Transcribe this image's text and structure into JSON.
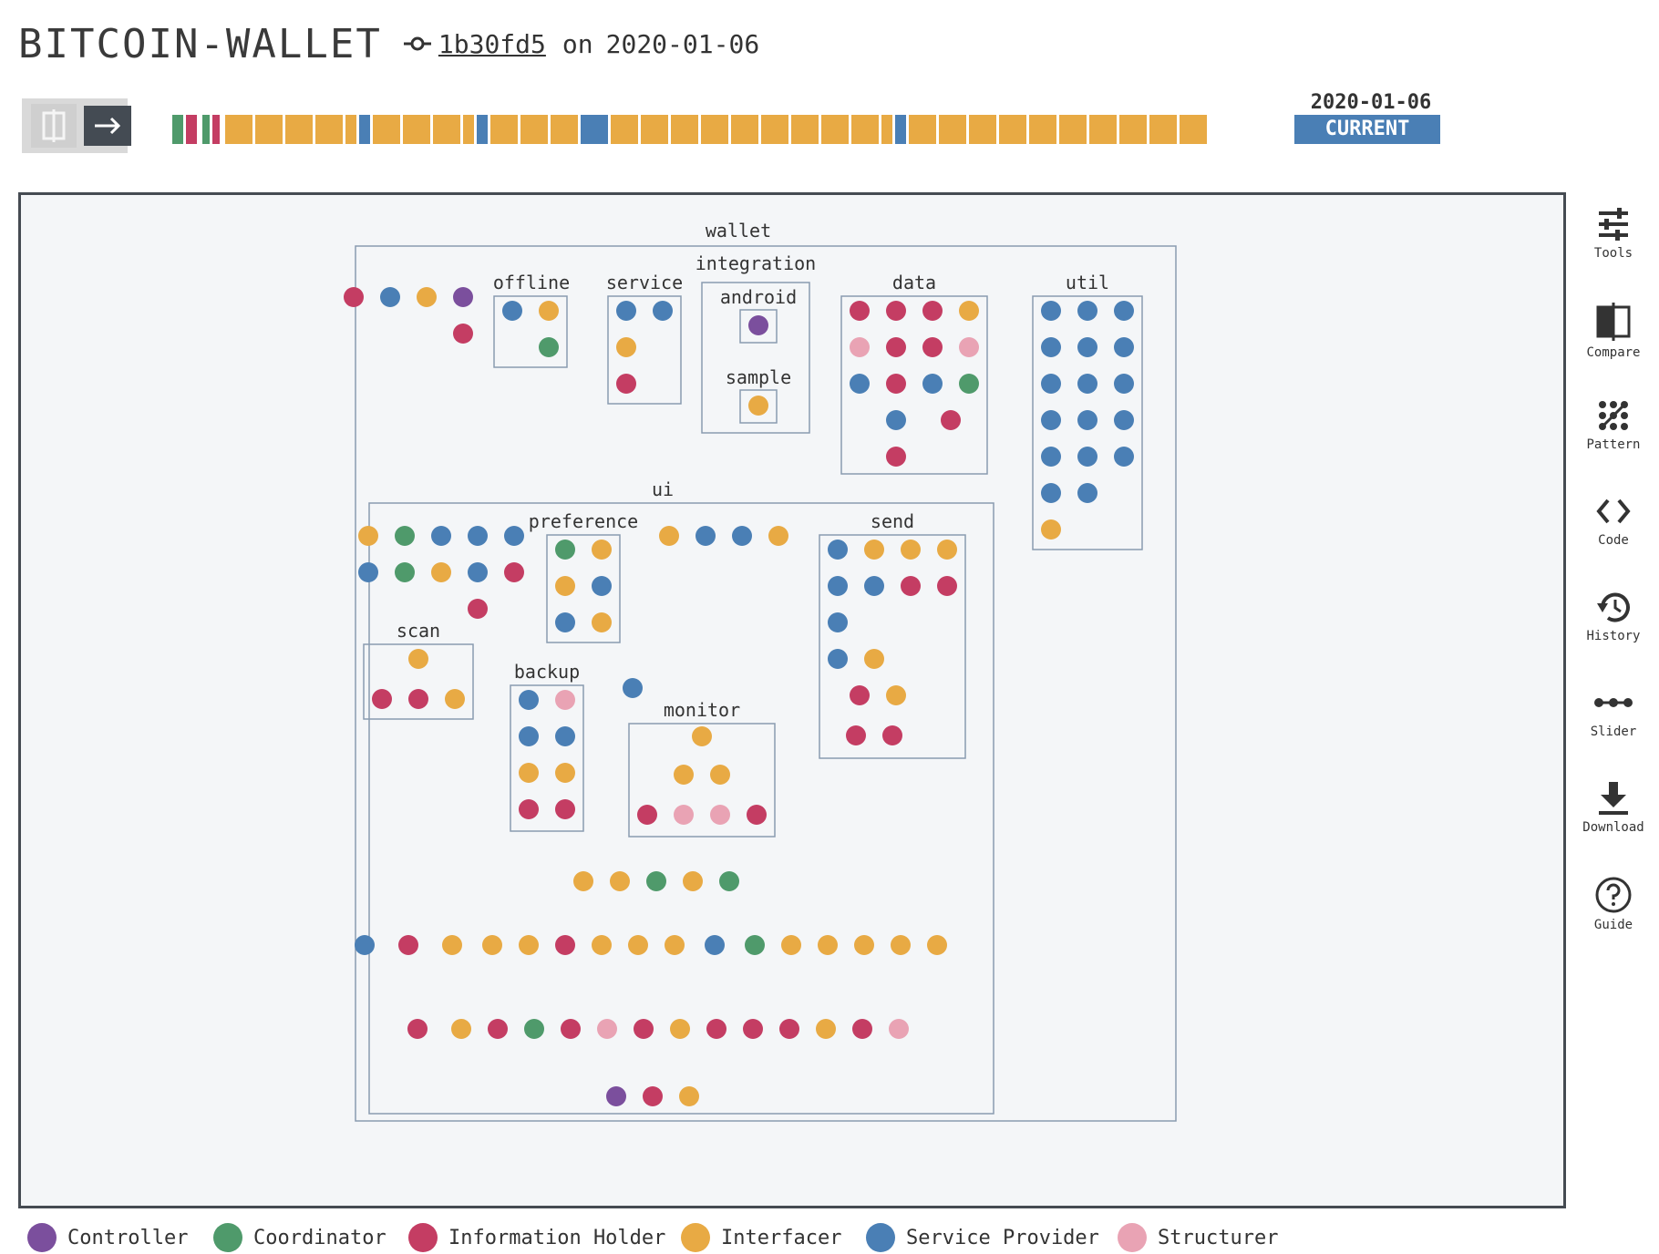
{
  "header": {
    "title": "BITCOIN-WALLET",
    "commit_hash": "1b30fd5",
    "on_label": "on",
    "commit_date": "2020-01-06"
  },
  "timeline": {
    "date_label": "2020-01-06",
    "current_label": "CURRENT",
    "segments": [
      "Coordinator",
      "Information Holder",
      "Interfacer",
      "Coordinator",
      "Information Holder",
      "Interfacer",
      "Interfacer",
      "Interfacer",
      "Interfacer",
      "Interfacer",
      "Interfacer",
      "Service Provider",
      "Interfacer",
      "Interfacer",
      "Interfacer",
      "Interfacer",
      "Service Provider",
      "Interfacer",
      "Interfacer",
      "Interfacer",
      "Service Provider",
      "Interfacer",
      "Interfacer",
      "Interfacer",
      "Interfacer",
      "Interfacer",
      "Interfacer",
      "Interfacer",
      "Interfacer",
      "Interfacer",
      "Interfacer",
      "Service Provider",
      "Interfacer",
      "Interfacer",
      "Interfacer",
      "Interfacer",
      "Interfacer",
      "Interfacer",
      "Interfacer",
      "Interfacer",
      "Interfacer",
      "Interfacer"
    ]
  },
  "colors": {
    "Controller": "#7b4f9d",
    "Coordinator": "#4f9a6b",
    "Information Holder": "#c43d63",
    "Interfacer": "#e8aa44",
    "Service Provider": "#4a7fb5",
    "Structurer": "#e9a3b4",
    "box_border": "#8a9bb0"
  },
  "tools": [
    {
      "label": "Tools",
      "icon": "sliders-icon"
    },
    {
      "label": "Compare",
      "icon": "compare-icon"
    },
    {
      "label": "Pattern",
      "icon": "pattern-icon"
    },
    {
      "label": "Code",
      "icon": "code-icon"
    },
    {
      "label": "History",
      "icon": "history-icon"
    },
    {
      "label": "Slider",
      "icon": "slider-icon"
    },
    {
      "label": "Download",
      "icon": "download-icon"
    },
    {
      "label": "Guide",
      "icon": "help-icon"
    }
  ],
  "legend": [
    {
      "label": "Controller",
      "key": "Controller"
    },
    {
      "label": "Coordinator",
      "key": "Coordinator"
    },
    {
      "label": "Information Holder",
      "key": "Information Holder"
    },
    {
      "label": "Interfacer",
      "key": "Interfacer"
    },
    {
      "label": "Service Provider",
      "key": "Service Provider"
    },
    {
      "label": "Structurer",
      "key": "Structurer"
    }
  ],
  "packages": [
    {
      "name": "wallet",
      "path": "wallet"
    },
    {
      "name": "offline",
      "path": "wallet.offline"
    },
    {
      "name": "service",
      "path": "wallet.service"
    },
    {
      "name": "integration",
      "path": "wallet.integration"
    },
    {
      "name": "android",
      "path": "wallet.integration.android"
    },
    {
      "name": "sample",
      "path": "wallet.integration.sample"
    },
    {
      "name": "data",
      "path": "wallet.data"
    },
    {
      "name": "util",
      "path": "wallet.util"
    },
    {
      "name": "ui",
      "path": "wallet.ui"
    },
    {
      "name": "preference",
      "path": "wallet.ui.preference"
    },
    {
      "name": "send",
      "path": "wallet.ui.send"
    },
    {
      "name": "scan",
      "path": "wallet.ui.scan"
    },
    {
      "name": "backup",
      "path": "wallet.ui.backup"
    },
    {
      "name": "monitor",
      "path": "wallet.ui.monitor"
    }
  ],
  "classes": {
    "wallet": [
      "Information Holder",
      "Service Provider",
      "Interfacer",
      "Controller",
      "Information Holder"
    ],
    "wallet.offline": [
      "Service Provider",
      "Interfacer",
      "Coordinator"
    ],
    "wallet.service": [
      "Service Provider",
      "Service Provider",
      "Interfacer",
      "Information Holder"
    ],
    "wallet.integration": [],
    "wallet.integration.android": [
      "Controller"
    ],
    "wallet.integration.sample": [
      "Interfacer"
    ],
    "wallet.data": [
      "Information Holder",
      "Information Holder",
      "Information Holder",
      "Interfacer",
      "Structurer",
      "Information Holder",
      "Information Holder",
      "Structurer",
      "Service Provider",
      "Information Holder",
      "Service Provider",
      "Coordinator",
      "Service Provider",
      "Information Holder",
      "Information Holder"
    ],
    "wallet.util": [
      "Service Provider",
      "Service Provider",
      "Service Provider",
      "Service Provider",
      "Service Provider",
      "Service Provider",
      "Service Provider",
      "Service Provider",
      "Service Provider",
      "Service Provider",
      "Service Provider",
      "Service Provider",
      "Service Provider",
      "Service Provider",
      "Service Provider",
      "Service Provider",
      "Service Provider",
      "Interfacer"
    ],
    "wallet.ui": [
      "Interfacer",
      "Coordinator",
      "Service Provider",
      "Service Provider",
      "Service Provider",
      "Service Provider",
      "Coordinator",
      "Interfacer",
      "Service Provider",
      "Information Holder",
      "Information Holder",
      "Interfacer",
      "Service Provider",
      "Service Provider",
      "Interfacer",
      "Service Provider",
      "Interfacer",
      "Interfacer",
      "Coordinator",
      "Interfacer",
      "Coordinator",
      "Service Provider",
      "Information Holder",
      "Interfacer",
      "Interfacer",
      "Interfacer",
      "Information Holder",
      "Interfacer",
      "Interfacer",
      "Interfacer",
      "Service Provider",
      "Coordinator",
      "Interfacer",
      "Interfacer",
      "Interfacer",
      "Interfacer",
      "Interfacer",
      "Information Holder",
      "Interfacer",
      "Information Holder",
      "Coordinator",
      "Information Holder",
      "Structurer",
      "Information Holder",
      "Interfacer",
      "Information Holder",
      "Information Holder",
      "Information Holder",
      "Interfacer",
      "Information Holder",
      "Structurer",
      "Controller",
      "Information Holder",
      "Interfacer"
    ],
    "wallet.ui.preference": [
      "Coordinator",
      "Interfacer",
      "Interfacer",
      "Service Provider",
      "Service Provider",
      "Interfacer"
    ],
    "wallet.ui.send": [
      "Service Provider",
      "Interfacer",
      "Interfacer",
      "Interfacer",
      "Service Provider",
      "Service Provider",
      "Information Holder",
      "Information Holder",
      "Service Provider",
      "Service Provider",
      "Interfacer",
      "Information Holder",
      "Interfacer",
      "Information Holder",
      "Information Holder"
    ],
    "wallet.ui.scan": [
      "Interfacer",
      "Information Holder",
      "Information Holder",
      "Interfacer"
    ],
    "wallet.ui.backup": [
      "Service Provider",
      "Structurer",
      "Service Provider",
      "Service Provider",
      "Interfacer",
      "Interfacer",
      "Information Holder",
      "Information Holder"
    ],
    "wallet.ui.monitor": [
      "Interfacer",
      "Interfacer",
      "Interfacer",
      "Information Holder",
      "Structurer",
      "Structurer",
      "Information Holder"
    ]
  }
}
